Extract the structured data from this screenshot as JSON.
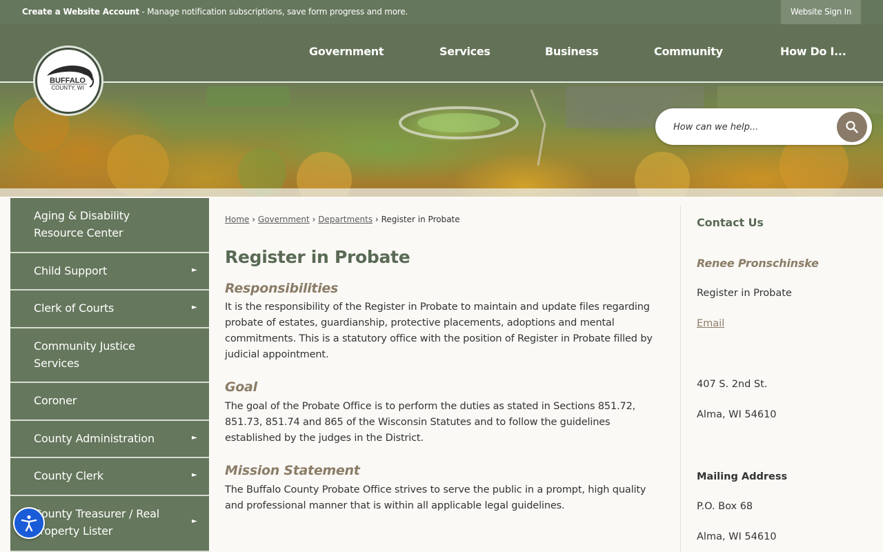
{
  "utility": {
    "create_account_label": "Create a Website Account",
    "create_account_desc": " - Manage notification subscriptions, save form progress and more.",
    "signin_label": "Website Sign In"
  },
  "logo": {
    "line1": "BUFFALO",
    "line2": "COUNTY, WI"
  },
  "nav": [
    {
      "label": "Government"
    },
    {
      "label": "Services"
    },
    {
      "label": "Business"
    },
    {
      "label": "Community"
    },
    {
      "label": "How Do I..."
    }
  ],
  "search": {
    "placeholder": "How can we help...",
    "icon": "search-icon"
  },
  "sidebar": {
    "items": [
      {
        "line1": "Aging & Disability",
        "line2": "Resource Center",
        "has_arrow": false
      },
      {
        "line1": "Child Support",
        "has_arrow": true
      },
      {
        "line1": "Clerk of Courts",
        "has_arrow": true
      },
      {
        "line1": "Community Justice",
        "line2": "Services",
        "has_arrow": false
      },
      {
        "line1": "Coroner",
        "has_arrow": false
      },
      {
        "line1": "County Administration",
        "has_arrow": true
      },
      {
        "line1": "County Clerk",
        "has_arrow": true
      },
      {
        "line1": "County Treasurer / Real",
        "line2": "Property Lister",
        "has_arrow": true
      }
    ],
    "arrow_glyph": "►"
  },
  "breadcrumb": {
    "items": [
      "Home",
      "Government",
      "Departments"
    ],
    "current": "Register in Probate",
    "separator": "›"
  },
  "main": {
    "title": "Register in Probate",
    "sections": [
      {
        "heading": "Responsibilities",
        "body": "It is the responsibility of the Register in Probate to maintain and update files regarding probate of estates, guardianship, protective placements, adoptions and mental commitments. This is a statutory office with the position of Register in Probate filled by judicial appointment."
      },
      {
        "heading": "Goal",
        "body": "The goal of the Probate Office is to perform the duties as stated in Sections 851.72, 851.73, 851.74 and 865 of the Wisconsin Statutes and to follow the guidelines established by the judges in the District."
      },
      {
        "heading": "Mission Statement",
        "body": "The Buffalo County Probate Office strives to serve the public in a prompt, high quality and professional manner that is within all applicable legal guidelines."
      }
    ]
  },
  "contact": {
    "title": "Contact Us",
    "name": "Renee Pronschinske",
    "role": "Register in Probate",
    "email_label": "Email",
    "street": "407 S. 2nd St.",
    "city": "Alma, WI 54610",
    "mailing_heading": "Mailing Address",
    "po_box": "P.O. Box 68",
    "mailing_city": "Alma, WI 54610"
  },
  "colors": {
    "header_green": "#637257",
    "sidebar_green": "#65775c",
    "heading_tan": "#8b7c67",
    "title_green": "#5a6a55",
    "accessibility_blue": "#1a5bd8"
  }
}
